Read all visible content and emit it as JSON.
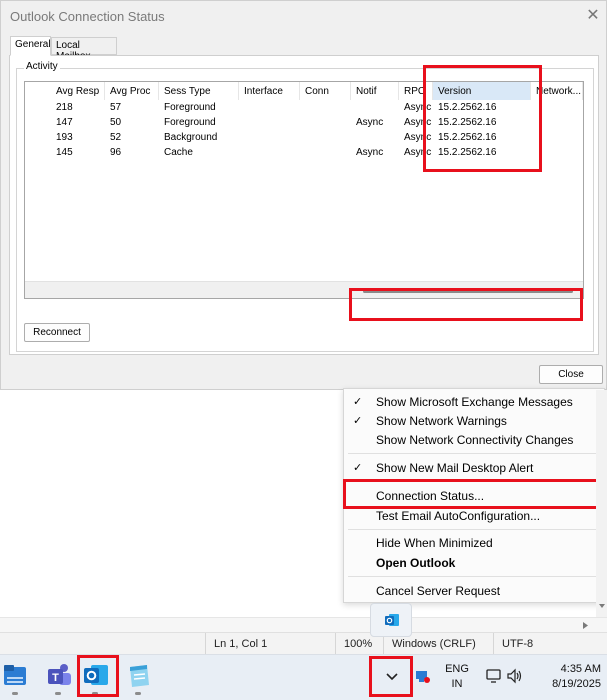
{
  "dialog": {
    "title": "Outlook Connection Status",
    "close_glyph": "✕",
    "tabs": [
      {
        "label": "General",
        "active": true
      },
      {
        "label": "Local Mailbox",
        "active": false
      }
    ],
    "group_label": "Activity",
    "columns": [
      "Avg Resp",
      "Avg Proc",
      "Sess Type",
      "Interface",
      "Conn",
      "Notif",
      "RPC",
      "Version",
      "Network..."
    ],
    "rows": [
      {
        "avg_resp": "218",
        "avg_proc": "57",
        "sess_type": "Foreground",
        "interface": "",
        "conn": "",
        "notif": "",
        "rpc": "Async",
        "version": "15.2.2562.16"
      },
      {
        "avg_resp": "147",
        "avg_proc": "50",
        "sess_type": "Foreground",
        "interface": "",
        "conn": "",
        "notif": "Async",
        "rpc": "Async",
        "version": "15.2.2562.16"
      },
      {
        "avg_resp": "193",
        "avg_proc": "52",
        "sess_type": "Background",
        "interface": "",
        "conn": "",
        "notif": "",
        "rpc": "Async",
        "version": "15.2.2562.16"
      },
      {
        "avg_resp": "145",
        "avg_proc": "96",
        "sess_type": "Cache",
        "interface": "",
        "conn": "",
        "notif": "Async",
        "rpc": "Async",
        "version": "15.2.2562.16"
      }
    ],
    "reconnect_label": "Reconnect",
    "close_label": "Close"
  },
  "context_menu": {
    "items": [
      {
        "label": "Show Microsoft Exchange Messages",
        "checked": true
      },
      {
        "label": "Show Network Warnings",
        "checked": true
      },
      {
        "label": "Show Network Connectivity Changes",
        "checked": false
      },
      {
        "label": "Show New Mail Desktop Alert",
        "checked": true
      },
      {
        "label": "Connection Status...",
        "checked": false
      },
      {
        "label": "Test Email AutoConfiguration...",
        "checked": false
      },
      {
        "label": "Hide When Minimized",
        "checked": false
      },
      {
        "label": "Open Outlook",
        "checked": false,
        "bold": true
      },
      {
        "label": "Cancel Server Request",
        "checked": false
      }
    ],
    "check_glyph": "✓"
  },
  "editor_status": {
    "position": "Ln 1, Col 1",
    "zoom": "100%",
    "line_endings": "Windows (CRLF)",
    "encoding": "UTF-8"
  },
  "taskbar": {
    "language_top": "ENG",
    "language_bottom": "IN",
    "time": "4:35 AM",
    "date": "8/19/2025",
    "chevron_glyph": "⌄",
    "apps": [
      "file-explorer-icon",
      "teams-icon",
      "outlook-icon",
      "notepad-icon"
    ]
  },
  "colors": {
    "highlight_red": "#e8101c",
    "outlook_blue": "#0f6cbd",
    "selected_header": "#d9e8f7"
  }
}
